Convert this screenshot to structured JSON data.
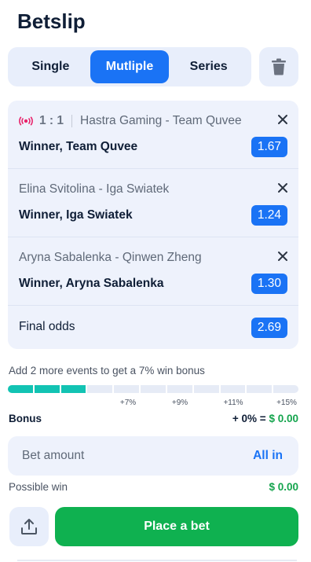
{
  "header": {
    "title": "Betslip"
  },
  "tabs": [
    {
      "label": "Single",
      "active": false
    },
    {
      "label": "Mutliple",
      "active": true
    },
    {
      "label": "Series",
      "active": false
    }
  ],
  "bets": [
    {
      "live": true,
      "score": "1 : 1",
      "event": "Hastra Gaming - Team Quvee",
      "pick": "Winner, Team Quvee",
      "odds": "1.67"
    },
    {
      "live": false,
      "score": "",
      "event": "Elina Svitolina - Iga Swiatek",
      "pick": "Winner, Iga Swiatek",
      "odds": "1.24"
    },
    {
      "live": false,
      "score": "",
      "event": "Aryna Sabalenka - Qinwen Zheng",
      "pick": "Winner, Aryna Sabalenka",
      "odds": "1.30"
    }
  ],
  "final": {
    "label": "Final odds",
    "odds": "2.69"
  },
  "bonus": {
    "hint": "Add 2 more events to get a 7% win bonus",
    "progress_filled_segments": 3,
    "progress_total_segments": 11,
    "ticks": [
      "+7%",
      "+9%",
      "+11%",
      "+15%"
    ],
    "label": "Bonus",
    "value_prefix": "+ 0% = ",
    "value_amount": "$ 0.00"
  },
  "amount": {
    "placeholder": "Bet amount",
    "all_in": "All in"
  },
  "possible_win": {
    "label": "Possible win",
    "value": "$ 0.00"
  },
  "actions": {
    "place_bet": "Place a bet"
  },
  "colors": {
    "accent": "#1a73f5",
    "green": "#0fb150",
    "live": "#e8236b",
    "progress": "#12c3b3"
  },
  "icons": {
    "trash": "trash-icon",
    "close": "close-icon",
    "live": "live-broadcast-icon",
    "share": "share-upload-icon"
  }
}
